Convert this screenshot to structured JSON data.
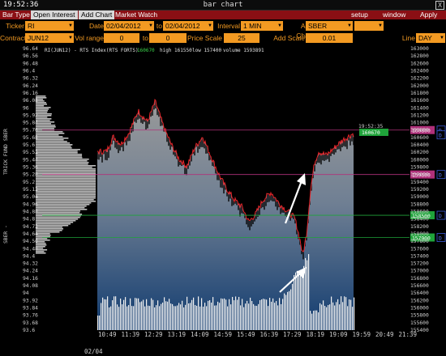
{
  "titlebar": {
    "clock": "19:52:36",
    "title": "bar chart",
    "close": "X"
  },
  "toolbar": {
    "bar_type": "Bar Type",
    "open_interest": "Open Interest",
    "add_chart": "Add Chart",
    "market_watch": "Market Watch",
    "setup": "setup",
    "window": "window",
    "apply": "Apply"
  },
  "params": {
    "ticker_label": "Ticker",
    "ticker": "RI",
    "date_label": "Date",
    "date_from": "02/04/2012",
    "to_label": "to",
    "date_to": "02/04/2012",
    "interval_label": "Interval",
    "interval": "1 MIN",
    "addchart_label": "Add Chart",
    "addchart": "SBER",
    "contract_label": "Contract",
    "contract": "JUN12",
    "volrange_label": "Vol range",
    "vol_from": "0",
    "volto_label": "to",
    "vol_to": "0",
    "pricescale_label": "Price Scale",
    "price_scale": "25",
    "addscale_label": "Add Scale",
    "add_scale": "0.01",
    "line_label": "Line",
    "line": "DAY"
  },
  "chart_info": {
    "prefix": "RI(JUN12) - RTS Index(RTS FORTS)",
    "last": "160670",
    "high": "high 161550",
    "low": "low 157400",
    "volume": "volume 1593891"
  },
  "side_labels": {
    "left_top": "TRICK FUND SBER",
    "left_bottom": "SBER -"
  },
  "markers": {
    "time_box": "19:52:35",
    "last_box": "160670",
    "marker_letter": "D"
  },
  "chart_data": {
    "type": "line",
    "price_series": "RI(JUN12)",
    "left_axis_ticks": [
      "96.64",
      "96.56",
      "96.48",
      "96.4",
      "96.32",
      "96.24",
      "96.16",
      "96.08",
      "96",
      "95.92",
      "95.84",
      "95.76",
      "95.68",
      "95.6",
      "95.52",
      "95.44",
      "95.36",
      "95.28",
      "95.2",
      "95.12",
      "95.04",
      "94.96",
      "94.88",
      "94.8",
      "94.72",
      "94.64",
      "94.56",
      "94.48",
      "94.4",
      "94.32",
      "94.24",
      "94.16",
      "94.08",
      "94",
      "93.92",
      "93.84",
      "93.76",
      "93.68",
      "93.6"
    ],
    "right_axis_ticks": [
      "163000",
      "162800",
      "162600",
      "162400",
      "162200",
      "162000",
      "161800",
      "161600",
      "161400",
      "161200",
      "161000",
      "160800",
      "160600",
      "160400",
      "160200",
      "160000",
      "159800",
      "159600",
      "159400",
      "159200",
      "159000",
      "158800",
      "158600",
      "158400",
      "158200",
      "158000",
      "157800",
      "157600",
      "157400",
      "157200",
      "157000",
      "156800",
      "156600",
      "156400",
      "156200",
      "156000",
      "155800",
      "155600",
      "155400"
    ],
    "x_ticks": [
      "10:49",
      "11:39",
      "12:29",
      "13:19",
      "14:09",
      "14:59",
      "15:49",
      "16:39",
      "17:29",
      "18:19",
      "19:09",
      "19:59",
      "20:49",
      "21:39"
    ],
    "date_label": "02/04",
    "price_range": [
      155400,
      163000
    ],
    "high": 161550,
    "low": 157400,
    "last": 160670,
    "level_lines": [
      {
        "value": 160800,
        "color": "#b0307a"
      },
      {
        "value": 159600,
        "color": "#b0307a"
      },
      {
        "value": 158500,
        "color": "#1fa33a"
      },
      {
        "value": 157900,
        "color": "#1fa33a"
      }
    ],
    "close_path": [
      [
        10.55,
        160200
      ],
      [
        10.8,
        160600
      ],
      [
        11.1,
        160400
      ],
      [
        11.4,
        160700
      ],
      [
        11.75,
        161300
      ],
      [
        12.1,
        161000
      ],
      [
        12.4,
        161550
      ],
      [
        12.7,
        160900
      ],
      [
        13.0,
        160400
      ],
      [
        13.3,
        160000
      ],
      [
        13.6,
        159800
      ],
      [
        13.9,
        160300
      ],
      [
        14.2,
        160600
      ],
      [
        14.5,
        160100
      ],
      [
        14.8,
        159600
      ],
      [
        15.1,
        159200
      ],
      [
        15.4,
        158900
      ],
      [
        15.7,
        158700
      ],
      [
        15.95,
        158300
      ],
      [
        16.2,
        158500
      ],
      [
        16.5,
        158900
      ],
      [
        16.8,
        159100
      ],
      [
        17.1,
        158800
      ],
      [
        17.4,
        158600
      ],
      [
        17.7,
        158400
      ],
      [
        17.9,
        157800
      ],
      [
        18.0,
        157400
      ],
      [
        18.15,
        158000
      ],
      [
        18.3,
        159200
      ],
      [
        18.45,
        159900
      ],
      [
        18.6,
        160200
      ],
      [
        18.9,
        160100
      ],
      [
        19.2,
        160300
      ],
      [
        19.5,
        160500
      ],
      [
        19.87,
        160670
      ]
    ],
    "volume_profile": "horizontal volume-at-price histogram on left side",
    "volume_bars": "vertical volume bars along bottom of plot",
    "annotations": [
      "white arrow pointing up-right near 17:30",
      "white arrow pointing up-right near 17:10 volume"
    ]
  }
}
